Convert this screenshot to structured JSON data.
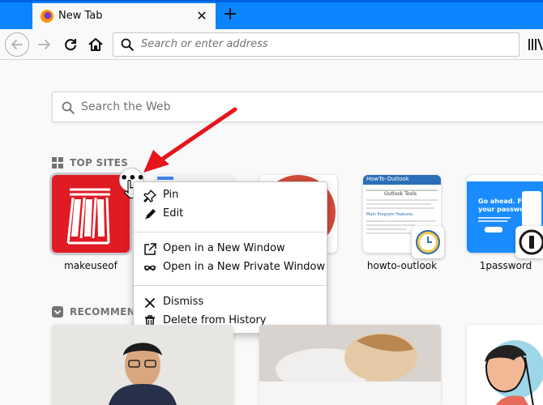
{
  "tab": {
    "title": "New Tab",
    "close": "✕"
  },
  "newtab_symbol": "+",
  "urlbar": {
    "placeholder": "Search or enter address"
  },
  "websearch": {
    "placeholder": "Search the Web"
  },
  "top_sites": {
    "heading": "TOP SITES",
    "tiles": [
      {
        "label": "makeuseof",
        "color": "#e01b24"
      },
      {
        "label": "",
        "color": "#ffffff"
      },
      {
        "label": "",
        "color": "#d24b3a"
      },
      {
        "label": "howto-outlook",
        "color": "#ffffff"
      },
      {
        "label": "1password",
        "color": "#1a8cff"
      }
    ],
    "outlook_thumb_text": [
      "HowTo-Outlook",
      "Outlook Tools",
      "Main Program Features"
    ],
    "onepassword_thumb_text": [
      "Go ahead. Forget",
      "your passwords."
    ]
  },
  "context_menu": {
    "items": [
      {
        "label": "Pin",
        "icon": "pin-icon"
      },
      {
        "label": "Edit",
        "icon": "pencil-icon"
      },
      {
        "label": "Open in a New Window",
        "icon": "new-window-icon"
      },
      {
        "label": "Open in a New Private Window",
        "icon": "private-mask-icon"
      },
      {
        "label": "Dismiss",
        "icon": "close-icon"
      },
      {
        "label": "Delete from History",
        "icon": "trash-icon"
      }
    ]
  },
  "ellipsis_label": "•••",
  "recommended": {
    "heading": "RECOMMENDED BY POCKET"
  },
  "colors": {
    "accent": "#0a84ff",
    "annotation_arrow": "#e8141c"
  }
}
